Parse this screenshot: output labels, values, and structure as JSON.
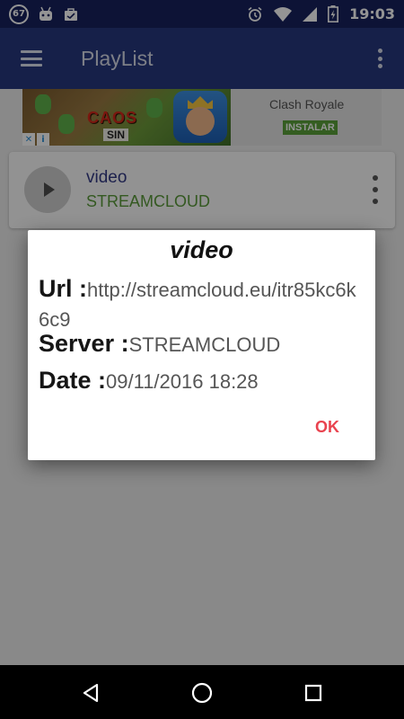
{
  "status_bar": {
    "notification_badge": "67",
    "time": "19:03",
    "icons": [
      "android-icon",
      "shopping-bag-icon",
      "alarm-icon",
      "wifi-icon",
      "signal-icon",
      "battery-icon"
    ]
  },
  "app_bar": {
    "title": "PlayList",
    "color": "#26377f"
  },
  "ad": {
    "game_text": "CAOS",
    "game_subtext": "SIN",
    "app_name": "Clash Royale",
    "install_label": "INSTALAR",
    "choices_i": "i",
    "choices_x": "✕"
  },
  "list": {
    "items": [
      {
        "title": "video",
        "server": "STREAMCLOUD"
      }
    ]
  },
  "dialog": {
    "title": "video",
    "url_label": "Url :",
    "url_value": "http://streamcloud.eu/itr85kc6k6c9",
    "server_label": "Server :",
    "server_value": "STREAMCLOUD",
    "date_label": "Date :",
    "date_value": "09/11/2016 18:28",
    "ok_label": "OK",
    "accent_color": "#e9434f"
  }
}
